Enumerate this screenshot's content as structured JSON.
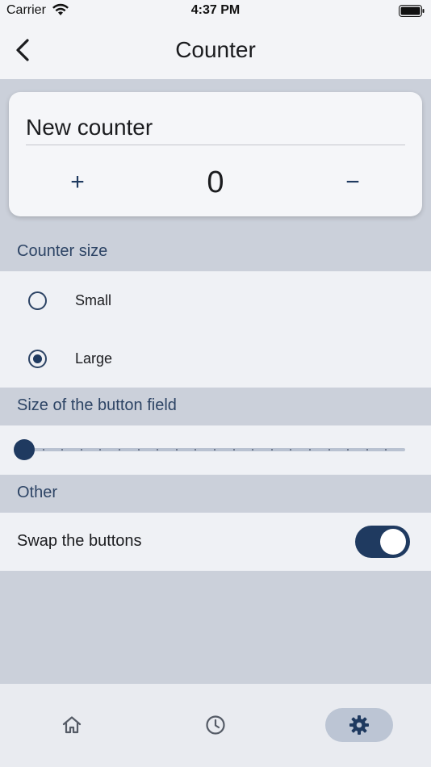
{
  "status_bar": {
    "carrier": "Carrier",
    "time": "4:37 PM"
  },
  "app_bar": {
    "title": "Counter",
    "back_icon": "chevron-left-icon"
  },
  "counter_card": {
    "name_value": "New counter",
    "plus_label": "+",
    "minus_label": "−",
    "value": "0"
  },
  "counter_size": {
    "header": "Counter size",
    "options": [
      {
        "label": "Small",
        "selected": false
      },
      {
        "label": "Large",
        "selected": true
      }
    ]
  },
  "button_field": {
    "header": "Size of the button field",
    "slider_level": 0
  },
  "other": {
    "header": "Other",
    "swap_label": "Swap the buttons",
    "swap_enabled": true
  },
  "bottom_nav": {
    "items": [
      {
        "icon": "home-icon",
        "active": false
      },
      {
        "icon": "clock-icon",
        "active": false
      },
      {
        "icon": "gear-icon",
        "active": true
      }
    ]
  },
  "colors": {
    "accent": "#1f3a60",
    "section_text": "#2d4465",
    "background": "#cbd0da",
    "panel": "#eff1f5"
  }
}
